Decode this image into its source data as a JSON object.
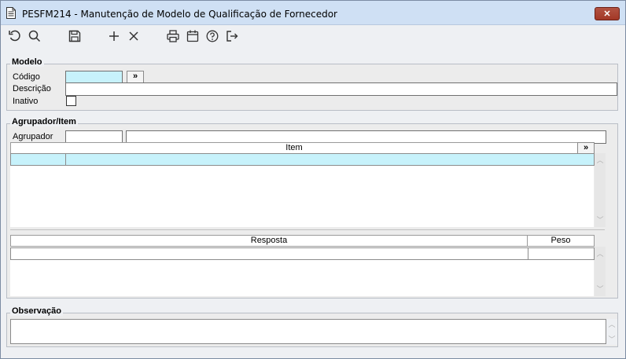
{
  "window": {
    "title": "PESFM214 - Manutenção de Modelo de Qualificação de Fornecedor",
    "close_label": "✕"
  },
  "toolbar": {
    "icons": [
      "undo-icon",
      "search-icon",
      "save-icon",
      "add-icon",
      "delete-icon",
      "print-icon",
      "calendar-icon",
      "help-icon",
      "exit-icon"
    ]
  },
  "modelo": {
    "legend": "Modelo",
    "codigo_label": "Código",
    "codigo_value": "",
    "more_button": "»",
    "descricao_label": "Descrição",
    "descricao_value": "",
    "inativo_label": "Inativo",
    "inativo_checked": false
  },
  "agrupador": {
    "legend": "Agrupador/Item",
    "agrupador_label": "Agrupador",
    "agrupador_code": "",
    "agrupador_desc": "",
    "item_header": "Item",
    "more_button": "»",
    "resposta_header": "Resposta",
    "peso_header": "Peso"
  },
  "observacao": {
    "legend": "Observação",
    "value": ""
  },
  "colors": {
    "highlight": "#c7f2fb",
    "titlebar": "#cfe0f4",
    "close": "#a33826"
  }
}
